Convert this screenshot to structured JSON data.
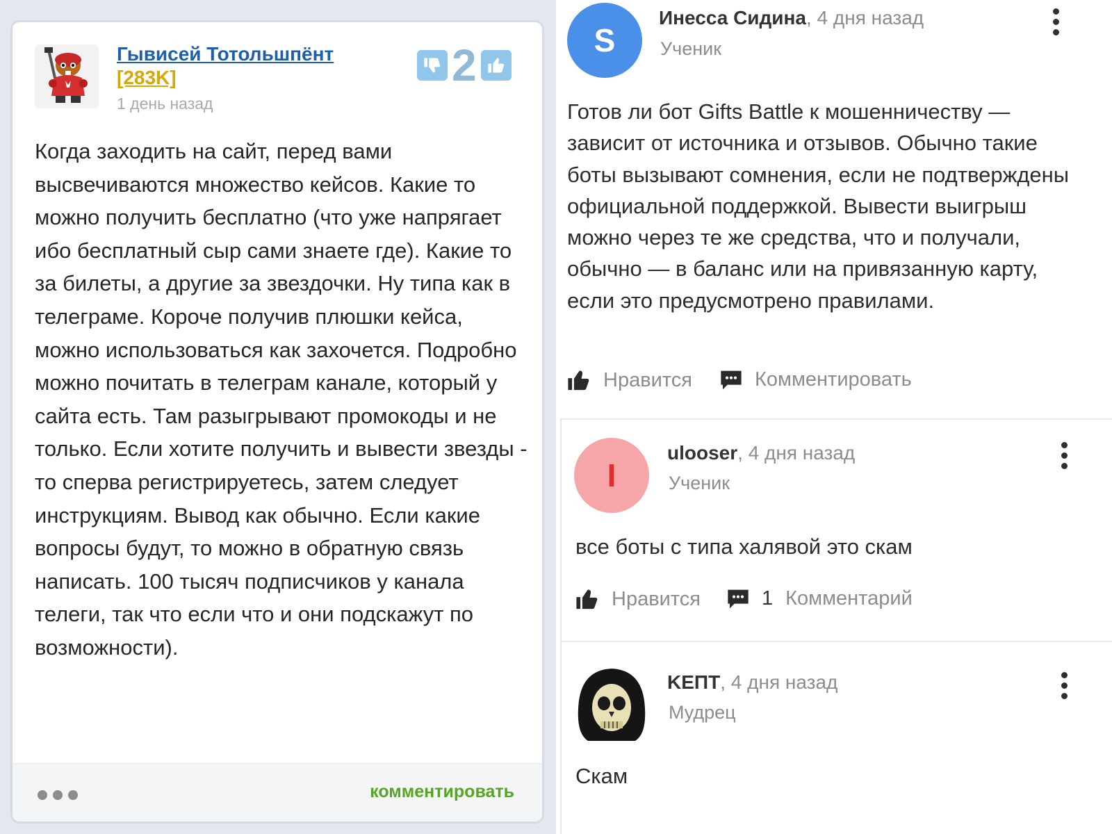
{
  "answer": {
    "author": "Гывисей Тотольшпёнт",
    "score": "[283K]",
    "time": "1 день назад",
    "votes": "2",
    "text": "Когда заходить на сайт, перед вами высвечиваются множество кейсов. Какие то можно получить бесплатно (что уже напрягает ибо бесплатный сыр сами знаете где). Какие то за билеты, а другие за звездочки. Ну типа как в телеграме. Короче получив плюшки кейса, можно использоваться как захочется. Подробно можно почитать в телеграм канале, который у сайта есть. Там разыгрывают промокоды и не только. Если хотите получить и вывести звезды - то сперва регистрируетесь, затем следует инструкциям. Вывод как обычно. Если какие вопросы будут, то можно в обратную связь написать. 100 тысяч подписчиков у канала телеги, так что если что и они подскажут по возможности).",
    "comment_label": "комментировать",
    "avatar_icon": "hockey-beaver-mascot-icon",
    "colors": {
      "link": "#1f5fa8",
      "score": "#d4a80a",
      "vote_button": "#8fc6ea",
      "comment_link": "#57a524"
    }
  },
  "comments": [
    {
      "avatar_letter": "S",
      "avatar_bg": "#4a8fe8",
      "avatar_fg": "#ffffff",
      "name": "Инесса Сидина",
      "time_suffix": ", 4 дня назад",
      "rank": "Ученик",
      "text": "Готов ли бот Gifts Battle к мошенничеству — зависит от источника и отзывов. Обычно такие боты вызывают сомнения, если не подтверждены официальной поддержкой. Вывести выигрыш можно через те же средства, что и получали, обычно — в баланс или на привязанную карту, если это предусмотрено правилами.",
      "like_label": "Нравится",
      "comment_label": "Комментировать"
    },
    {
      "avatar_letter": "I",
      "avatar_bg": "#f6a6a8",
      "avatar_fg": "#e22c2c",
      "name": "ulooser",
      "time_suffix": ", 4 дня назад",
      "rank": "Ученик",
      "text": "все боты с типа халявой это скам",
      "like_label": "Нравится",
      "comment_count": "1",
      "comment_label": "Комментарий"
    },
    {
      "avatar_icon": "skull-hood-avatar-icon",
      "name": "KΕΠΤ",
      "time_suffix": ", 4 дня назад",
      "rank": "Мудрец",
      "text": "Скам"
    }
  ],
  "icons": {
    "thumb_down": "thumbs-down-icon",
    "thumb_up": "thumbs-up-icon",
    "like": "thumbs-up-icon",
    "comment": "comment-bubble-icon",
    "more": "kebab-menu-icon",
    "answer_more": "more-horizontal-icon"
  }
}
